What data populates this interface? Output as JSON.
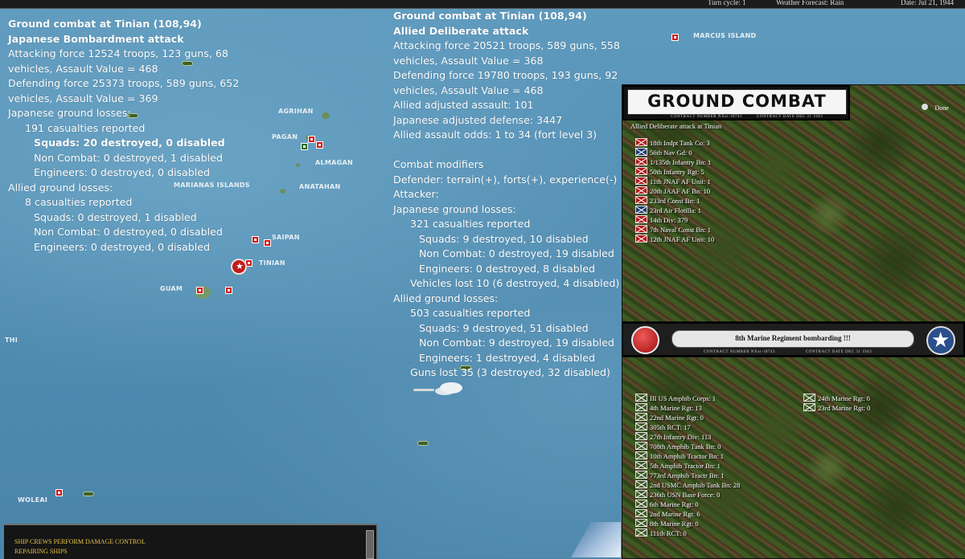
{
  "topbar": {
    "turn_cycle": "Turn cycle: 1",
    "weather": "Weather Forecast: Rain",
    "date": "Date: Jul 21, 1944"
  },
  "left_report": {
    "title": "Ground combat at Tinian (108,94)",
    "subtitle": "Japanese Bombardment attack",
    "lines": [
      "Attacking force 12524 troops, 123 guns, 68",
      "vehicles, Assault Value = 468",
      "Defending force 25373 troops, 589 guns, 652",
      "vehicles, Assault Value = 369",
      "Japanese ground losses:",
      "191 casualties reported",
      "Squads: 20 destroyed, 0 disabled",
      "Non Combat: 0 destroyed, 1 disabled",
      "Engineers: 0 destroyed, 0 disabled",
      "Allied ground losses:",
      "8 casualties reported",
      "Squads: 0 destroyed, 1 disabled",
      "Non Combat: 0 destroyed, 0 disabled",
      "Engineers: 0 destroyed, 0 disabled"
    ]
  },
  "right_report": {
    "title": "Ground combat at Tinian (108,94)",
    "subtitle": "Allied Deliberate attack",
    "lines": [
      "Attacking force 20521 troops, 589 guns, 558",
      "vehicles, Assault Value = 368",
      "Defending force 19780 troops, 193 guns, 92",
      "vehicles, Assault Value = 468",
      "Allied adjusted assault: 101",
      "Japanese adjusted defense: 3447",
      "Allied assault odds: 1 to 34 (fort level 3)",
      "Combat modifiers",
      "Defender: terrain(+), forts(+), experience(-)",
      "Attacker:",
      "Japanese ground losses:",
      "321 casualties reported",
      "Squads: 9 destroyed, 10 disabled",
      "Non Combat: 0 destroyed, 19 disabled",
      "Engineers: 0 destroyed, 8 disabled",
      "Vehicles lost 10 (6 destroyed, 4 disabled)",
      "Allied ground losses:",
      "503 casualties reported",
      "Squads: 9 destroyed, 51 disabled",
      "Non Combat: 9 destroyed, 19 disabled",
      "Engineers: 1 destroyed, 4 disabled",
      "Guns lost 35 (3 destroyed, 32 disabled)"
    ]
  },
  "map_labels": {
    "marcus": "MARCUS ISLAND",
    "agrihan": "AGRIHAN",
    "pagan": "PAGAN",
    "almagan": "ALMAGAN",
    "marianas": "MARIANAS ISLANDS",
    "anatahan": "ANATAHAN",
    "saipan": "SAIPAN",
    "tinian": "TINIAN",
    "guam": "GUAM",
    "thi": "THI",
    "woleai": "WOLEAI"
  },
  "ground_combat_panel": {
    "banner_title": "GROUND COMBAT",
    "contract_left": "CONTRACT NUMBER  NXss-18743",
    "contract_right": "CONTRACT DATE  DEC 31 1943",
    "done_label": "Done",
    "attack_caption": "Allied Deliberate attack at Tinian",
    "units": [
      {
        "label": "18th Indpt Tank Co: 3",
        "color": "red"
      },
      {
        "label": "56th Nav Gd: 0",
        "color": "blue"
      },
      {
        "label": "1/135th Infantry Bn: 1",
        "color": "red"
      },
      {
        "label": "50th Infantry Rgt: 5",
        "color": "red"
      },
      {
        "label": "11th JNAF AF Unit: 1",
        "color": "red"
      },
      {
        "label": "20th JAAF AF Bn: 10",
        "color": "red"
      },
      {
        "label": "233rd Const Bn: 1",
        "color": "red"
      },
      {
        "label": "23rd Air Flotilla: 1",
        "color": "blue"
      },
      {
        "label": "14th Div: 379",
        "color": "red"
      },
      {
        "label": "7th Naval Const Bn: 1",
        "color": "red"
      },
      {
        "label": "12th JNAF AF Unit: 10",
        "color": "red"
      }
    ]
  },
  "allied_panel": {
    "banner_text": "8th Marine Regiment bombarding !!!",
    "contract_left": "CONTRACT NUMBER  NXss-18743",
    "contract_right": "CONTRACT DATE  DEC 31 1943",
    "units_left": [
      "III US Amphib Corps: 1",
      "4th Marine Rgt: 13",
      "22nd Marine Rgt: 0",
      "305th RCT: 17",
      "27th Infantry Div: 113",
      "708th Amphib Tank Bn: 0",
      "10th Amphib Tractor Bn: 1",
      "5th Amphib Tractor Bn: 1",
      "773rd Amphib Tractr Bn: 1",
      "2nd USMC Amphib Tank Bn: 28",
      "236th USN Base Force: 0",
      "6th Marine Rgt: 0",
      "2nd Marine Rgt: 6",
      "8th Marine Rgt: 0",
      "111th RCT: 0"
    ],
    "units_right": [
      "24th Marine Rgt: 0",
      "23rd Marine Rgt: 0"
    ]
  },
  "message_bar": {
    "line1": "SHIP CREWS PERFORM DAMAGE CONTROL",
    "line2": "REPAIRING SHIPS"
  }
}
